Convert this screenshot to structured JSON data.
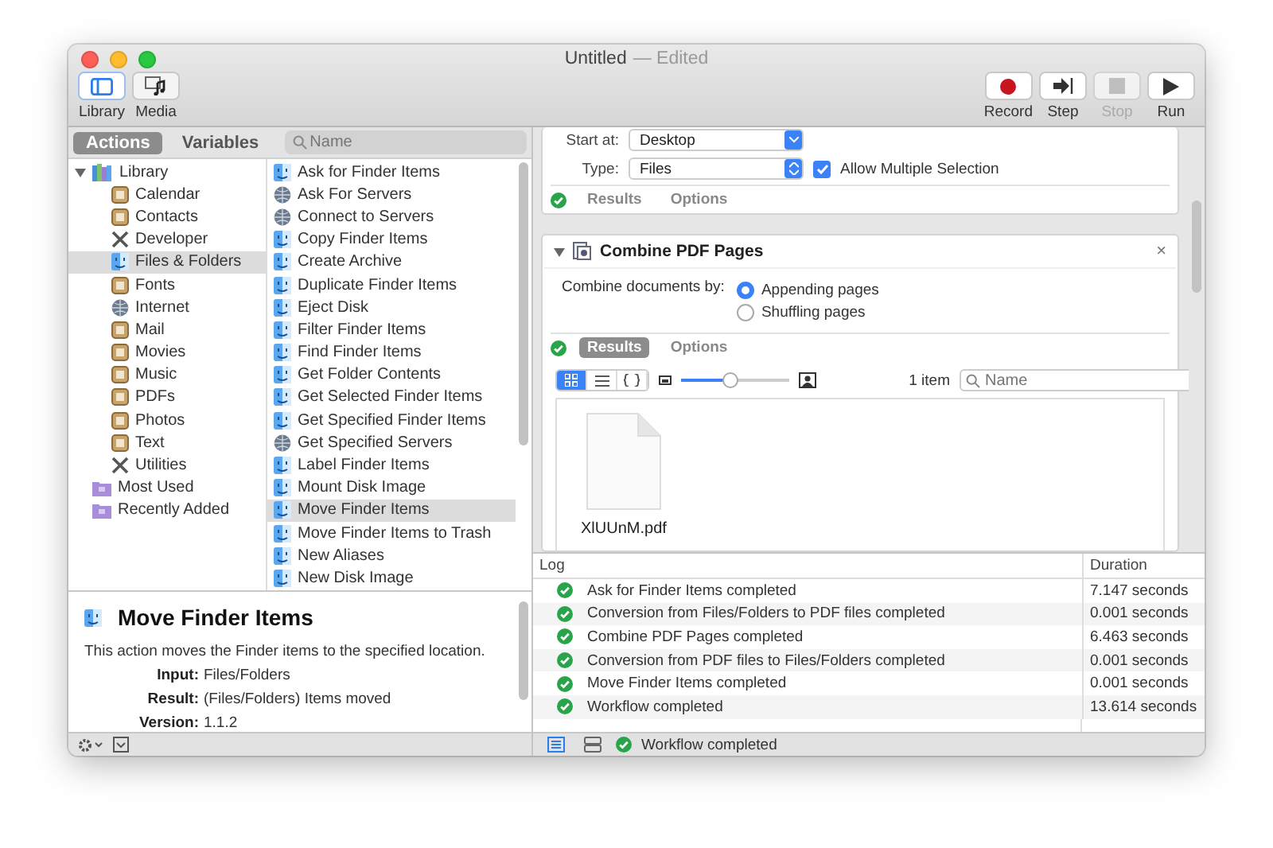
{
  "window": {
    "title": "Untitled",
    "edited": "— Edited"
  },
  "toolbar": {
    "left": [
      {
        "label": "Library",
        "kind": "library",
        "selected": true
      },
      {
        "label": "Media",
        "kind": "media",
        "selected": false
      }
    ],
    "right": [
      {
        "label": "Record",
        "kind": "record",
        "disabled": false
      },
      {
        "label": "Step",
        "kind": "step",
        "disabled": false
      },
      {
        "label": "Stop",
        "kind": "stop",
        "disabled": true
      },
      {
        "label": "Run",
        "kind": "run",
        "disabled": false
      }
    ]
  },
  "library_tabs": [
    {
      "label": "Actions",
      "selected": true
    },
    {
      "label": "Variables",
      "selected": false
    }
  ],
  "library_search": {
    "placeholder": "Name"
  },
  "categories": [
    {
      "label": "Library",
      "kind": "library",
      "expanded": true,
      "selected": false,
      "children": [
        {
          "label": "Calendar",
          "kind": "category",
          "selected": false
        },
        {
          "label": "Contacts",
          "kind": "category",
          "selected": false
        },
        {
          "label": "Developer",
          "kind": "tools",
          "selected": false
        },
        {
          "label": "Files & Folders",
          "kind": "finder",
          "selected": true
        },
        {
          "label": "Fonts",
          "kind": "category",
          "selected": false
        },
        {
          "label": "Internet",
          "kind": "globe",
          "selected": false
        },
        {
          "label": "Mail",
          "kind": "category",
          "selected": false
        },
        {
          "label": "Movies",
          "kind": "category",
          "selected": false
        },
        {
          "label": "Music",
          "kind": "category",
          "selected": false
        },
        {
          "label": "PDFs",
          "kind": "category",
          "selected": false
        },
        {
          "label": "Photos",
          "kind": "category",
          "selected": false
        },
        {
          "label": "Text",
          "kind": "category",
          "selected": false
        },
        {
          "label": "Utilities",
          "kind": "tools",
          "selected": false
        }
      ]
    },
    {
      "label": "Most Used",
      "kind": "folder",
      "selected": false
    },
    {
      "label": "Recently Added",
      "kind": "folder",
      "selected": false
    }
  ],
  "actions": [
    {
      "label": "Ask for Finder Items",
      "kind": "finder",
      "selected": false
    },
    {
      "label": "Ask For Servers",
      "kind": "globe",
      "selected": false
    },
    {
      "label": "Connect to Servers",
      "kind": "globe",
      "selected": false
    },
    {
      "label": "Copy Finder Items",
      "kind": "finder",
      "selected": false
    },
    {
      "label": "Create Archive",
      "kind": "finder",
      "selected": false
    },
    {
      "label": "Duplicate Finder Items",
      "kind": "finder",
      "selected": false
    },
    {
      "label": "Eject Disk",
      "kind": "finder",
      "selected": false
    },
    {
      "label": "Filter Finder Items",
      "kind": "finder",
      "selected": false
    },
    {
      "label": "Find Finder Items",
      "kind": "finder",
      "selected": false
    },
    {
      "label": "Get Folder Contents",
      "kind": "finder",
      "selected": false
    },
    {
      "label": "Get Selected Finder Items",
      "kind": "finder",
      "selected": false
    },
    {
      "label": "Get Specified Finder Items",
      "kind": "finder",
      "selected": false
    },
    {
      "label": "Get Specified Servers",
      "kind": "globe",
      "selected": false
    },
    {
      "label": "Label Finder Items",
      "kind": "finder",
      "selected": false
    },
    {
      "label": "Mount Disk Image",
      "kind": "finder",
      "selected": false
    },
    {
      "label": "Move Finder Items",
      "kind": "finder",
      "selected": true
    },
    {
      "label": "Move Finder Items to Trash",
      "kind": "finder",
      "selected": false
    },
    {
      "label": "New Aliases",
      "kind": "finder",
      "selected": false
    },
    {
      "label": "New Disk Image",
      "kind": "finder",
      "selected": false
    }
  ],
  "description": {
    "title": "Move Finder Items",
    "text": "This action moves the Finder items to the specified location.",
    "fields": [
      {
        "label": "Input:",
        "value": "Files/Folders"
      },
      {
        "label": "Result:",
        "value": "(Files/Folders) Items moved"
      },
      {
        "label": "Version:",
        "value": "1.1.2"
      }
    ]
  },
  "ask_block": {
    "start_label": "Start at:",
    "start_value": "Desktop",
    "type_label": "Type:",
    "type_value": "Files",
    "allow_multiple": {
      "label": "Allow Multiple Selection",
      "checked": true
    },
    "footer_tabs": [
      {
        "label": "Results",
        "selected": false
      },
      {
        "label": "Options",
        "selected": false
      }
    ]
  },
  "combine_block": {
    "title": "Combine PDF Pages",
    "expanded": true,
    "close": "×",
    "option_label": "Combine documents by:",
    "options": [
      {
        "label": "Appending pages",
        "selected": true
      },
      {
        "label": "Shuffling pages",
        "selected": false
      }
    ],
    "footer_tabs": [
      {
        "label": "Results",
        "selected": true
      },
      {
        "label": "Options",
        "selected": false
      }
    ],
    "view_modes": [
      {
        "kind": "icons",
        "selected": true
      },
      {
        "kind": "list",
        "selected": false
      },
      {
        "kind": "code",
        "selected": false
      }
    ],
    "zoom": {
      "level": 0.45
    },
    "count": "1 item",
    "search": {
      "placeholder": "Name"
    },
    "files": [
      {
        "name": "XlUUnM.pdf"
      }
    ]
  },
  "log": {
    "columns": [
      "Log",
      "Duration"
    ],
    "rows": [
      {
        "message": "Ask for Finder Items completed",
        "duration": "7.147 seconds"
      },
      {
        "message": "Conversion from Files/Folders to PDF files completed",
        "duration": "0.001 seconds"
      },
      {
        "message": "Combine PDF Pages completed",
        "duration": "6.463 seconds"
      },
      {
        "message": "Conversion from PDF files to Files/Folders completed",
        "duration": "0.001 seconds"
      },
      {
        "message": "Move Finder Items completed",
        "duration": "0.001 seconds"
      },
      {
        "message": "Workflow completed",
        "duration": "13.614 seconds"
      }
    ]
  },
  "log_views": [
    {
      "kind": "log",
      "selected": true
    },
    {
      "kind": "split",
      "selected": false
    }
  ],
  "status": {
    "text": "Workflow completed"
  }
}
